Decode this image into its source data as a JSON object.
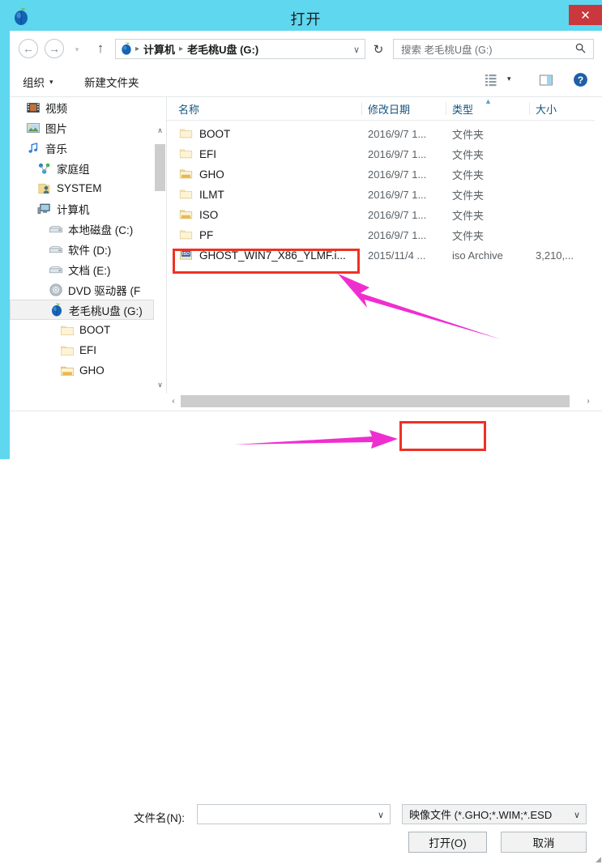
{
  "window": {
    "title": "打开",
    "app_icon": "peach-icon",
    "close_label": "✕",
    "accent_color": "#5ed7ef",
    "close_color": "#c9383c",
    "highlight_color": "#ef3124",
    "arrow_color": "#ef2ed0"
  },
  "nav": {
    "back": "←",
    "forward": "→",
    "recent": "▾",
    "up": "↑",
    "address_icon": "peach-icon",
    "breadcrumbs": [
      "计算机",
      "老毛桃U盘 (G:)"
    ],
    "breadcrumb_sep": "▸",
    "address_dropdown": "∨",
    "refresh": "↻",
    "search_placeholder": "搜索 老毛桃U盘 (G:)",
    "search_value": "",
    "search_icon": "search-icon"
  },
  "toolbar": {
    "organize": "组织",
    "new_folder": "新建文件夹",
    "caret": "▾",
    "view_icon": "view-grid-icon",
    "view_caret": "▾",
    "preview_icon": "preview-pane-icon",
    "help_icon": "help-icon"
  },
  "sidebar": {
    "items": [
      {
        "label": "视频",
        "icon": "video-icon",
        "indent": 0,
        "selected": false
      },
      {
        "label": "图片",
        "icon": "picture-icon",
        "indent": 0,
        "selected": false
      },
      {
        "label": "音乐",
        "icon": "music-icon",
        "indent": 0,
        "selected": false
      },
      {
        "label": "家庭组",
        "icon": "homegroup-icon",
        "indent": 1,
        "selected": false
      },
      {
        "label": "SYSTEM",
        "icon": "folder-user-icon",
        "indent": 1,
        "selected": false
      },
      {
        "label": "计算机",
        "icon": "computer-icon",
        "indent": 1,
        "selected": false
      },
      {
        "label": "本地磁盘 (C:)",
        "icon": "drive-icon",
        "indent": 2,
        "selected": false
      },
      {
        "label": "软件 (D:)",
        "icon": "drive-icon",
        "indent": 2,
        "selected": false
      },
      {
        "label": "文档 (E:)",
        "icon": "drive-icon",
        "indent": 2,
        "selected": false
      },
      {
        "label": "DVD 驱动器 (F",
        "icon": "dvd-icon",
        "indent": 2,
        "selected": false
      },
      {
        "label": "老毛桃U盘 (G:)",
        "icon": "peach-icon",
        "indent": 2,
        "selected": true
      },
      {
        "label": "BOOT",
        "icon": "folder-icon",
        "indent": 3,
        "selected": false
      },
      {
        "label": "EFI",
        "icon": "folder-icon",
        "indent": 3,
        "selected": false
      },
      {
        "label": "GHO",
        "icon": "folder-full-icon",
        "indent": 3,
        "selected": false
      }
    ],
    "scroll_up": "∧",
    "scroll_down": "∨"
  },
  "filelist": {
    "columns": [
      {
        "label": "名称",
        "sorted": false
      },
      {
        "label": "修改日期",
        "sorted": false
      },
      {
        "label": "类型",
        "sorted": true,
        "sort_arrow": "▲"
      },
      {
        "label": "大小",
        "sorted": false
      }
    ],
    "rows": [
      {
        "name": "BOOT",
        "date": "2016/9/7 1...",
        "type": "文件夹",
        "size": "",
        "icon": "folder-icon",
        "highlighted": false
      },
      {
        "name": "EFI",
        "date": "2016/9/7 1...",
        "type": "文件夹",
        "size": "",
        "icon": "folder-icon",
        "highlighted": false
      },
      {
        "name": "GHO",
        "date": "2016/9/7 1...",
        "type": "文件夹",
        "size": "",
        "icon": "folder-full-icon",
        "highlighted": false
      },
      {
        "name": "ILMT",
        "date": "2016/9/7 1...",
        "type": "文件夹",
        "size": "",
        "icon": "folder-icon",
        "highlighted": false
      },
      {
        "name": "ISO",
        "date": "2016/9/7 1...",
        "type": "文件夹",
        "size": "",
        "icon": "folder-full-icon",
        "highlighted": false
      },
      {
        "name": "PF",
        "date": "2016/9/7 1...",
        "type": "文件夹",
        "size": "",
        "icon": "folder-icon",
        "highlighted": false
      },
      {
        "name": "GHOST_WIN7_X86_YLMF.i...",
        "date": "2015/11/4 ...",
        "type": "iso Archive",
        "size": "3,210,...",
        "icon": "iso-icon",
        "highlighted": true
      }
    ],
    "hscroll_left": "‹",
    "hscroll_right": "›"
  },
  "footer": {
    "filename_label": "文件名(N):",
    "filename_value": "",
    "filename_placeholder": "",
    "filename_dropdown": "∨",
    "filter_value": "映像文件 (*.GHO;*.WIM;*.ESD",
    "filter_dropdown": "∨",
    "open_button": "打开(O)",
    "cancel_button": "取消",
    "resize_grip": "◢"
  }
}
